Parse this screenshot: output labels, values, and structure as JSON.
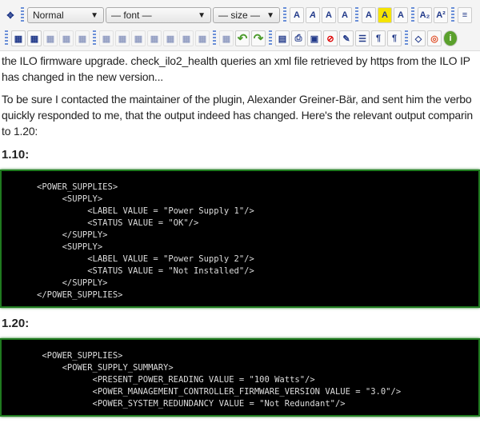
{
  "toolbar": {
    "style_select": "Normal",
    "font_select": "— font —",
    "size_select": "— size —",
    "row1_icons": [
      [
        "bold-text-icon",
        "A"
      ],
      [
        "italic-text-icon",
        "A"
      ],
      [
        "large-text-icon",
        "A"
      ],
      [
        "outline-text-icon",
        "A"
      ],
      [
        "text-color-icon",
        "A"
      ],
      [
        "highlight-color-icon",
        "A"
      ],
      [
        "plain-text-icon",
        "A"
      ],
      [
        "subscript-icon",
        "A₂"
      ],
      [
        "superscript-icon",
        "A²"
      ],
      [
        "align-left-icon",
        "≡"
      ]
    ],
    "row2_icons": [
      "table-icon",
      "table-properties-icon",
      "cell-properties-icon",
      "row-properties-icon",
      "merge-cells-icon",
      "insert-column-before-icon",
      "insert-column-after-icon",
      "delete-column-icon",
      "insert-row-before-icon",
      "insert-row-after-icon",
      "delete-row-icon",
      "split-cell-icon",
      "table-grid-icon",
      "undo-icon",
      "redo-icon",
      "paste-word-icon",
      "print-icon",
      "save-icon",
      "remove-font-icon",
      "eraser-icon",
      "horizontal-rule-icon",
      "ltr-icon",
      "rtl-icon",
      "source-code-icon",
      "help-icon",
      "info-icon"
    ]
  },
  "article": {
    "p1_line1": "the ILO firmware upgrade. check_ilo2_health queries an xml file retrieved by https from the ILO IP",
    "p1_line2": "has changed in the new version...",
    "p2_line1": "To be sure I contacted the maintainer of the plugin, Alexander Greiner-Bär, and sent him the verbo",
    "p2_line2": "quickly responded to me, that the output indeed has changed. Here's the relevant output comparin",
    "p2_line3": "to 1.20:",
    "h_110": "1.10:",
    "code_110": [
      "<POWER_SUPPLIES>",
      "     <SUPPLY>",
      "          <LABEL VALUE = \"Power Supply 1\"/>",
      "          <STATUS VALUE = \"OK\"/>",
      "     </SUPPLY>",
      "     <SUPPLY>",
      "          <LABEL VALUE = \"Power Supply 2\"/>",
      "          <STATUS VALUE = \"Not Installed\"/>",
      "     </SUPPLY>",
      "</POWER_SUPPLIES>"
    ],
    "h_120": "1.20:",
    "code_120": [
      " <POWER_SUPPLIES>",
      "     <POWER_SUPPLY_SUMMARY>",
      "           <PRESENT_POWER_READING VALUE = \"100 Watts\"/>",
      "           <POWER_MANAGEMENT_CONTROLLER_FIRMWARE_VERSION VALUE = \"3.0\"/>",
      "           <POWER_SYSTEM_REDUNDANCY VALUE = \"Not Redundant\"/>"
    ]
  }
}
